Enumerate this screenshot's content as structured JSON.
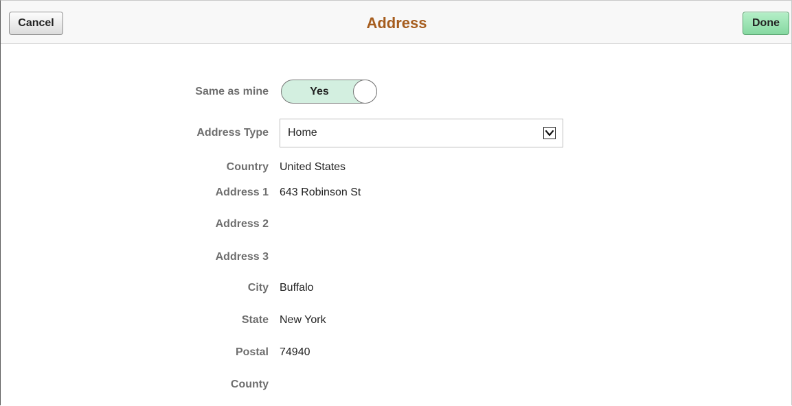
{
  "header": {
    "title": "Address",
    "cancel_label": "Cancel",
    "done_label": "Done"
  },
  "form": {
    "same_as_mine": {
      "label": "Same as mine",
      "toggle_value": "Yes"
    },
    "address_type": {
      "label": "Address Type",
      "selected": "Home"
    },
    "country": {
      "label": "Country",
      "value": "United States"
    },
    "address1": {
      "label": "Address 1",
      "value": "643 Robinson St"
    },
    "address2": {
      "label": "Address 2",
      "value": ""
    },
    "address3": {
      "label": "Address 3",
      "value": ""
    },
    "city": {
      "label": "City",
      "value": "Buffalo"
    },
    "state": {
      "label": "State",
      "value": "New York"
    },
    "postal": {
      "label": "Postal",
      "value": "74940"
    },
    "county": {
      "label": "County",
      "value": ""
    }
  },
  "colors": {
    "title": "#a65d1e",
    "done_button": "#9fe6b6",
    "toggle_on": "#d3efe0",
    "label": "#6e6e6e"
  },
  "icons": {
    "dropdown": "chevron-down-icon"
  }
}
